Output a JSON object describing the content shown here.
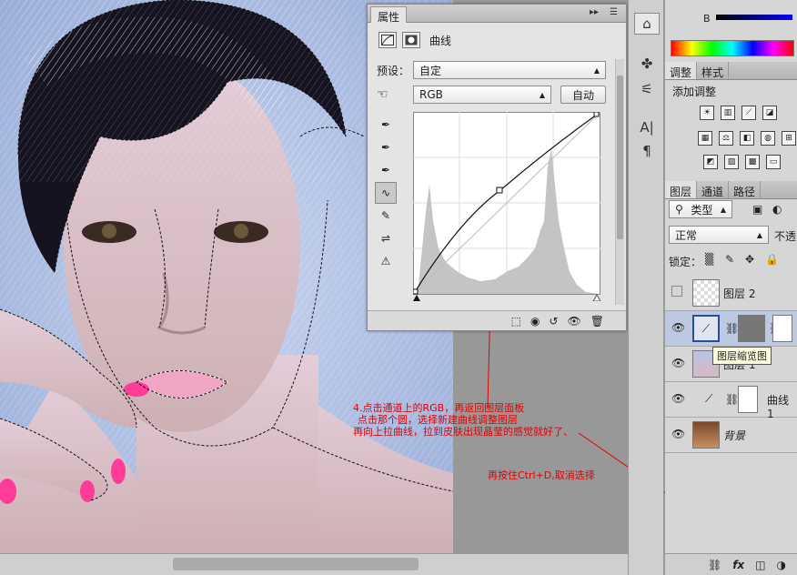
{
  "properties_panel": {
    "title": "属性",
    "header_label": "曲线",
    "preset_label": "预设：",
    "preset_value": "自定",
    "channel_value": "RGB",
    "auto_button": "自动"
  },
  "right_panels": {
    "color": {
      "channel_label": "B"
    },
    "adjustments": {
      "tabs": [
        "调整",
        "样式"
      ],
      "add_label": "添加调整"
    },
    "layers": {
      "tabs": [
        "图层",
        "通道",
        "路径"
      ],
      "filter_value": "类型",
      "blend_mode": "正常",
      "opacity_label": "不透",
      "lock_label": "锁定：",
      "items": [
        {
          "name": "图层 2",
          "visible": false
        },
        {
          "name": "",
          "visible": true
        },
        {
          "name": "图层 1",
          "visible": true
        },
        {
          "name": "曲线 1",
          "visible": true
        },
        {
          "name": "背景",
          "visible": true
        }
      ],
      "tooltip": "图层缩览图"
    }
  },
  "annotations": {
    "lines": [
      "4.点击通道上的RGB，再返回图层面板",
      "点击那个圆，选择新建曲线调整图层",
      "再向上拉曲线，拉到皮肤出现晶莹的感觉就好了、"
    ],
    "ctrl_d": "再按住Ctrl+D,取消选择"
  },
  "colors": {
    "panel_bg": "#e4e4e4",
    "annotation": "#e20000"
  }
}
